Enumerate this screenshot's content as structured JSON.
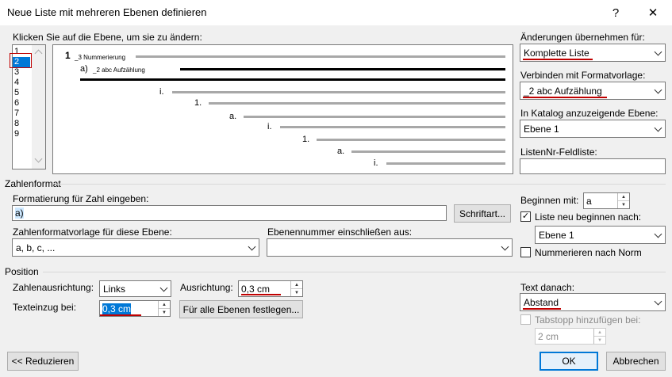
{
  "window": {
    "title": "Neue Liste mit mehreren Ebenen definieren",
    "help_label": "?",
    "close_label": "✕"
  },
  "level_picker": {
    "label": "Klicken Sie auf die Ebene, um sie zu ändern:",
    "levels": [
      "1",
      "2",
      "3",
      "4",
      "5",
      "6",
      "7",
      "8",
      "9"
    ],
    "selected": "2"
  },
  "preview": {
    "level1_num": "1",
    "level1_style": "_3 Nummerierung",
    "level2_num": "a)",
    "level2_style": "_2 abc Aufzählung",
    "items": [
      "i.",
      "1.",
      "a.",
      "i.",
      "1.",
      "a.",
      "i."
    ]
  },
  "right_panel": {
    "apply_label": "Änderungen übernehmen für:",
    "apply_value": "Komplette Liste",
    "link_label": "Verbinden mit Formatvorlage:",
    "link_value": "_2 abc Aufzählung",
    "gallery_label": "In Katalog anzuzeigende Ebene:",
    "gallery_value": "Ebene 1",
    "listnum_label": "ListenNr-Feldliste:",
    "listnum_value": ""
  },
  "number_format": {
    "group_label": "Zahlenformat",
    "format_label": "Formatierung für Zahl eingeben:",
    "format_value": "a)",
    "font_button": "Schriftart...",
    "style_label": "Zahlenformatvorlage für diese Ebene:",
    "style_value": "a, b, c, ...",
    "include_label": "Ebenennummer einschließen aus:",
    "include_value": "",
    "start_label": "Beginnen mit:",
    "start_value": "a",
    "restart_label": "Liste neu beginnen nach:",
    "restart_value": "Ebene 1",
    "legal_label": "Nummerieren nach Norm"
  },
  "position": {
    "group_label": "Position",
    "alignment_label": "Zahlenausrichtung:",
    "alignment_value": "Links",
    "aligned_at_label": "Ausrichtung:",
    "aligned_at_value": "0,3 cm",
    "indent_label": "Texteinzug bei:",
    "indent_value": "0,3 cm",
    "set_all_button": "Für alle Ebenen festlegen...",
    "follow_label": "Text danach:",
    "follow_value": "Abstand",
    "tabstop_label": "Tabstopp hinzufügen bei:",
    "tabstop_value": "2 cm"
  },
  "footer": {
    "reduce_button": "<< Reduzieren",
    "ok_button": "OK",
    "cancel_button": "Abbrechen"
  },
  "colors": {
    "annotation_red": "#c00000",
    "selection_blue": "#0078d7"
  }
}
